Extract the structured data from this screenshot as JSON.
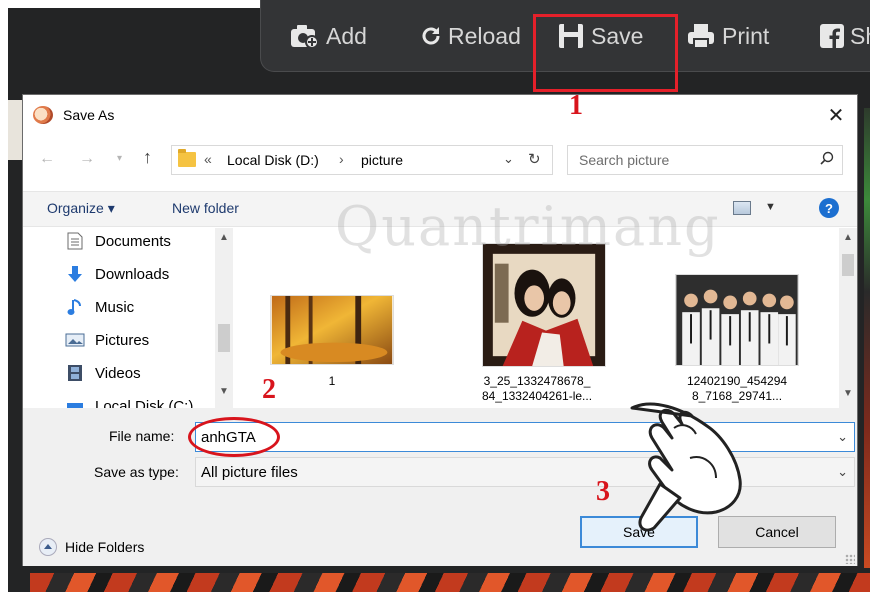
{
  "app_toolbar": {
    "add_label": "Add",
    "reload_label": "Reload",
    "save_label": "Save",
    "print_label": "Print",
    "share_label": "Sh",
    "icons": [
      "camera-add-icon",
      "reload-icon",
      "floppy-save-icon",
      "printer-icon",
      "facebook-icon"
    ]
  },
  "annotations": {
    "step1": "1",
    "step2": "2",
    "step3": "3",
    "highlight_color": "#e5202a"
  },
  "dialog": {
    "title": "Save As",
    "close_glyph": "✕",
    "address": {
      "chevron": "«",
      "crumbs": [
        "Local Disk (D:)",
        "picture"
      ],
      "separator": "›"
    },
    "search": {
      "placeholder": "Search picture"
    },
    "command_bar": {
      "organize": "Organize ▾",
      "new_folder": "New folder",
      "help": "?"
    },
    "nav_pane": {
      "items": [
        {
          "label": "Documents",
          "icon": "documents-icon"
        },
        {
          "label": "Downloads",
          "icon": "downloads-icon"
        },
        {
          "label": "Music",
          "icon": "music-icon"
        },
        {
          "label": "Pictures",
          "icon": "pictures-icon"
        },
        {
          "label": "Videos",
          "icon": "videos-icon"
        },
        {
          "label": "Local Disk (C:)",
          "icon": "drive-icon"
        }
      ]
    },
    "files": [
      {
        "name": "1",
        "thumb": "autumn-forest"
      },
      {
        "name": "3_25_1332478678_ 84_1332404261-le...",
        "thumb": "couple-portrait"
      },
      {
        "name": "12402190_454294 8_7168_29741...",
        "thumb": "group-photo"
      }
    ],
    "watermark": "Quantrimang",
    "file_name": {
      "label": "File name:",
      "value": "anhGTA"
    },
    "save_as_type": {
      "label": "Save as type:",
      "value": "All picture files"
    },
    "hide_folders": "Hide Folders",
    "save_button": "Save",
    "cancel_button": "Cancel"
  }
}
